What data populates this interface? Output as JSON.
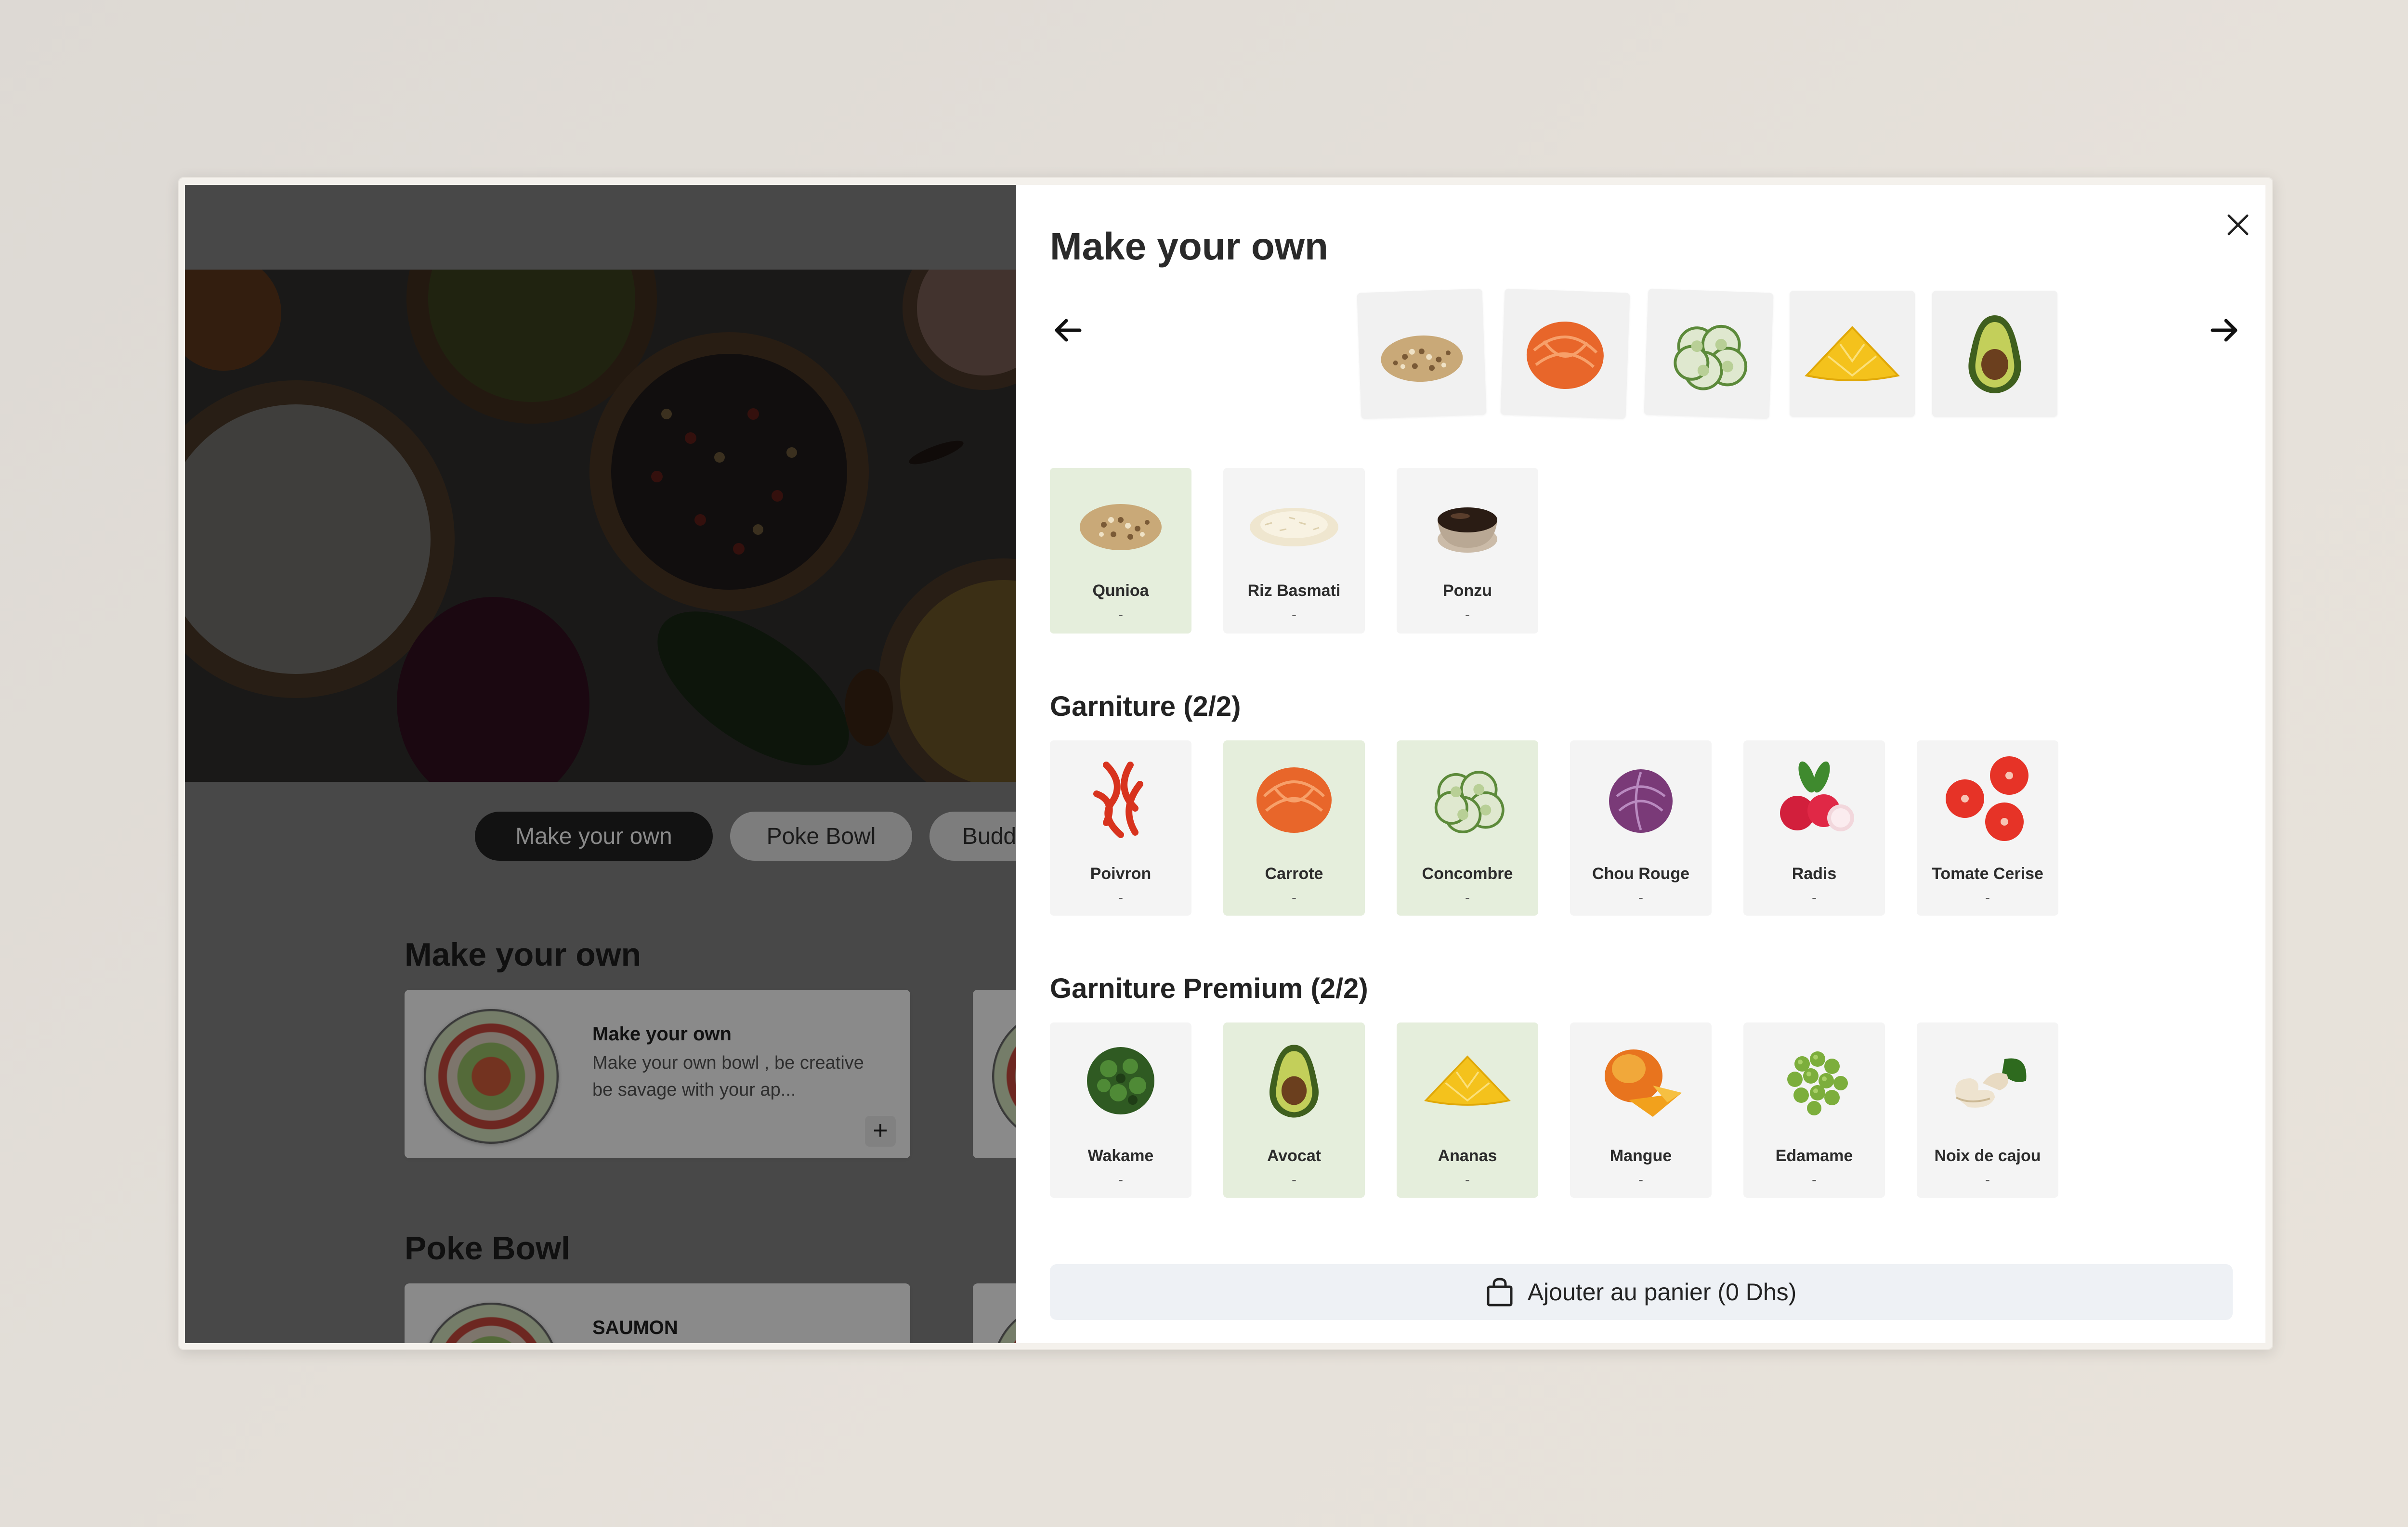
{
  "left": {
    "categories": [
      {
        "label": "Make your own",
        "active": true
      },
      {
        "label": "Poke Bowl",
        "active": false
      },
      {
        "label": "Budd",
        "active": false
      }
    ],
    "sections": [
      {
        "title": "Make your own",
        "product": {
          "title": "Make your own",
          "description": "Make your own bowl , be creative be savage with your ap...",
          "add": "+"
        }
      },
      {
        "title": "Poke Bowl",
        "product": {
          "title": "SAUMON"
        }
      }
    ]
  },
  "panel": {
    "title": "Make your own",
    "carousel": [
      "quinoa",
      "carrot",
      "cucumber",
      "pineapple",
      "avocado"
    ],
    "base": {
      "items": [
        {
          "name": "Qunioa",
          "value": "-",
          "selected": true
        },
        {
          "name": "Riz Basmati",
          "value": "-",
          "selected": false
        },
        {
          "name": "Ponzu",
          "value": "-",
          "selected": false
        }
      ]
    },
    "garniture": {
      "title": "Garniture (2/2)",
      "items": [
        {
          "name": "Poivron",
          "value": "-",
          "selected": false
        },
        {
          "name": "Carrote",
          "value": "-",
          "selected": true
        },
        {
          "name": "Concombre",
          "value": "-",
          "selected": true
        },
        {
          "name": "Chou Rouge",
          "value": "-",
          "selected": false
        },
        {
          "name": "Radis",
          "value": "-",
          "selected": false
        },
        {
          "name": "Tomate Cerise",
          "value": "-",
          "selected": false
        }
      ]
    },
    "premium": {
      "title": "Garniture Premium (2/2)",
      "items": [
        {
          "name": "Wakame",
          "value": "-",
          "selected": false
        },
        {
          "name": "Avocat",
          "value": "-",
          "selected": true
        },
        {
          "name": "Ananas",
          "value": "-",
          "selected": true
        },
        {
          "name": "Mangue",
          "value": "-",
          "selected": false
        },
        {
          "name": "Edamame",
          "value": "-",
          "selected": false
        },
        {
          "name": "Noix de cajou",
          "value": "-",
          "selected": false
        }
      ]
    },
    "cart_label": "Ajouter au panier (0 Dhs)"
  },
  "colors": {
    "selected_tile": "#e5eedc",
    "tile": "#f4f4f4",
    "cart_button": "#eef1f5",
    "active_pill": "#222222"
  }
}
